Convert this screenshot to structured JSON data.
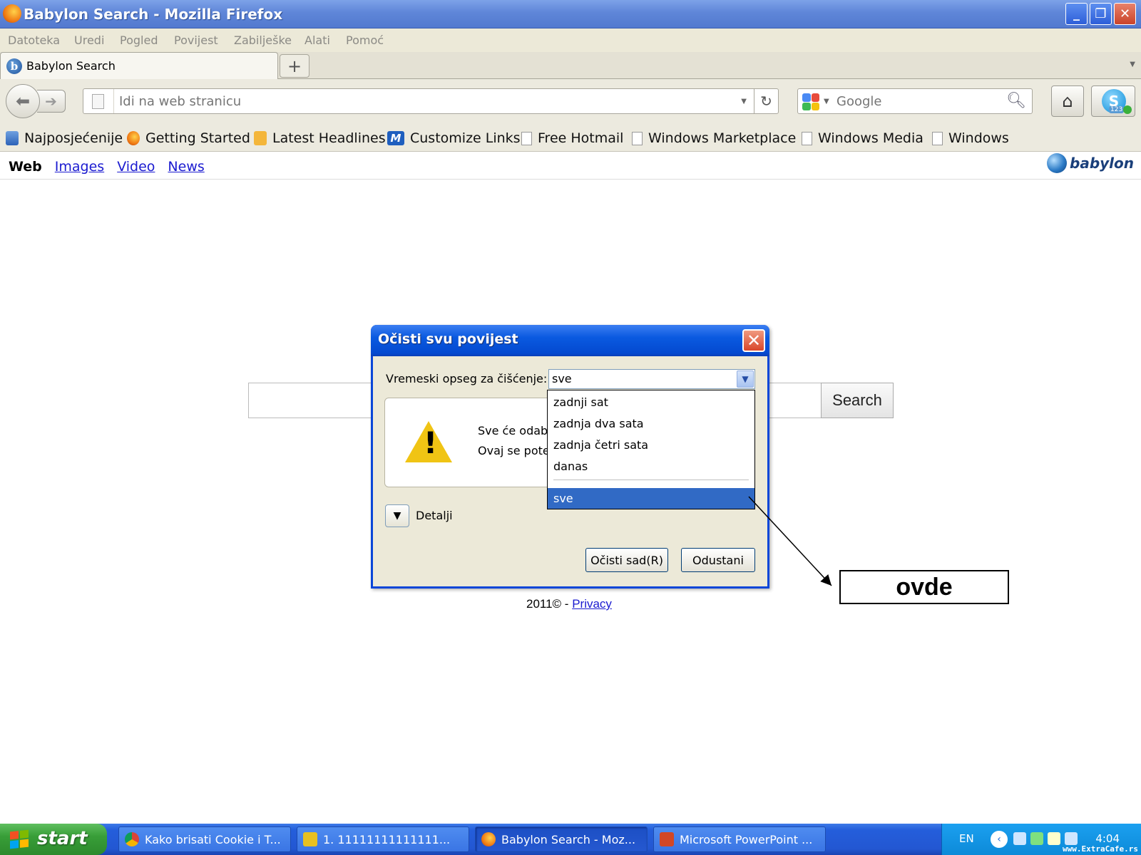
{
  "window": {
    "title": "Babylon Search - Mozilla Firefox",
    "controls": {
      "minimize": "_",
      "maximize": "❐",
      "close": "✕"
    }
  },
  "menubar": [
    "Datoteka",
    "Uredi",
    "Pogled",
    "Povijest",
    "Zabilješke",
    "Alati",
    "Pomoć"
  ],
  "tabs": {
    "active_label": "Babylon Search",
    "new_tab": "+"
  },
  "navbar": {
    "url_placeholder": "Idi na web stranicu",
    "search_placeholder": "Google",
    "skype_badge": "123"
  },
  "bookmarks": [
    {
      "label": "Najposjećenije",
      "icon": "smart-folder-icon"
    },
    {
      "label": "Getting Started",
      "icon": "firefox-icon"
    },
    {
      "label": "Latest Headlines",
      "icon": "rss-icon"
    },
    {
      "label": "Customize Links",
      "icon": "msn-icon"
    },
    {
      "label": "Free Hotmail",
      "icon": "page-icon"
    },
    {
      "label": "Windows Marketplace",
      "icon": "page-icon"
    },
    {
      "label": "Windows Media",
      "icon": "page-icon"
    },
    {
      "label": "Windows",
      "icon": "page-icon"
    }
  ],
  "page": {
    "vertical_tabs": {
      "web": "Web",
      "images": "Images",
      "video": "Video",
      "news": "News"
    },
    "logo": "babylon",
    "search_button": "Search",
    "footer": {
      "copyright": "2011© - ",
      "privacy": "Privacy"
    }
  },
  "dialog": {
    "title": "Očisti svu povijest",
    "range_label": "Vremeski opseg za čišćenje:",
    "range_value": "sve",
    "message_line1": "Sve će odabr",
    "message_line2": "Ovaj se pote",
    "details_label": "Detalji",
    "clear_button": "Očisti sad(R)",
    "cancel_button": "Odustani",
    "dropdown_options": [
      "zadnji sat",
      "zadnja dva sata",
      "zadnja četri sata",
      "danas",
      "sve"
    ],
    "selected_option": "sve"
  },
  "annotation": {
    "label": "ovde"
  },
  "taskbar": {
    "start": "start",
    "tasks": [
      {
        "label": "Kako brisati Cookie i T...",
        "icon": "chrome-icon"
      },
      {
        "label": "1. 11111111111111...",
        "icon": "notes-icon"
      },
      {
        "label": "Babylon Search - Moz...",
        "icon": "firefox-icon"
      },
      {
        "label": "Microsoft PowerPoint ...",
        "icon": "powerpoint-icon"
      }
    ],
    "language": "EN",
    "clock": "4:04"
  },
  "watermark": "www.ExtraCafe.rs",
  "colors": {
    "xp_blue": "#245edb",
    "selection": "#316ac5",
    "link": "#1a1ad0",
    "warning": "#f0c414"
  }
}
